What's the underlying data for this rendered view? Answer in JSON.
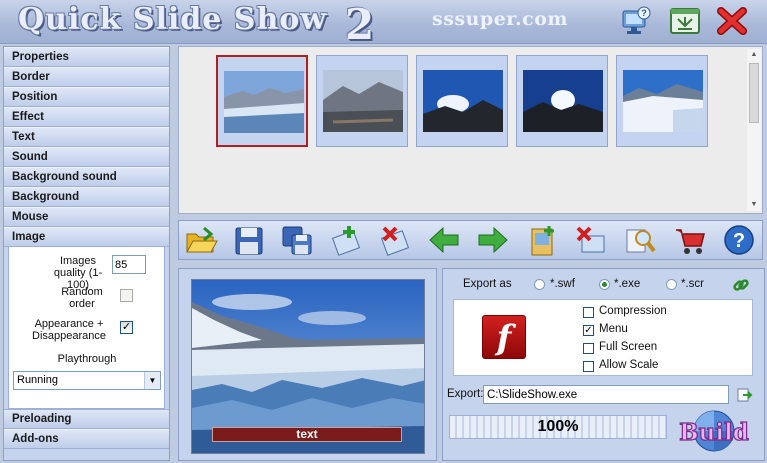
{
  "app": {
    "title": "Quick Slide Show",
    "version": "2",
    "brand": "sssuper.com"
  },
  "window_buttons": [
    "help-monitor",
    "restore",
    "close"
  ],
  "sidebar": {
    "sections_top": [
      {
        "label": "Properties"
      },
      {
        "label": "Border"
      },
      {
        "label": "Position"
      },
      {
        "label": "Effect"
      },
      {
        "label": "Text"
      },
      {
        "label": "Sound"
      },
      {
        "label": "Background sound"
      },
      {
        "label": "Background"
      },
      {
        "label": "Mouse"
      },
      {
        "label": "Image"
      }
    ],
    "image_panel": {
      "quality_label": "Images quality (1-100)",
      "quality_value": "85",
      "random_label": "Random order",
      "random_checked": false,
      "appearance_label": "Appearance + Disappearance",
      "appearance_checked": true,
      "playthrough_label": "Playthrough",
      "playthrough_value": "Running"
    },
    "sections_bottom": [
      {
        "label": "Preloading"
      },
      {
        "label": "Add-ons"
      }
    ]
  },
  "thumbnails": {
    "selected_index": 0,
    "count": 5
  },
  "toolbar": {
    "icons": [
      "open-folder-icon",
      "save-icon",
      "save-as-icon",
      "add-image-icon",
      "remove-image-icon",
      "move-left-icon",
      "move-right-icon",
      "add-to-album-icon",
      "delete-icon",
      "zoom-icon",
      "cart-icon",
      "help-icon"
    ]
  },
  "preview": {
    "caption": "text"
  },
  "export": {
    "export_as_label": "Export as",
    "formats": [
      {
        "label": "*.swf",
        "selected": false
      },
      {
        "label": "*.exe",
        "selected": true
      },
      {
        "label": "*.scr",
        "selected": false
      }
    ],
    "options": [
      {
        "label": "Compression",
        "checked": false
      },
      {
        "label": "Menu",
        "checked": true
      },
      {
        "label": "Full Screen",
        "checked": false
      },
      {
        "label": "Allow Scale",
        "checked": false
      }
    ],
    "path_label": "Export:",
    "path_value": "C:\\SlideShow.exe",
    "progress_text": "100%",
    "progress": 1.0,
    "build_label": "Build"
  },
  "colors": {
    "accent": "#b12020",
    "panel": "#c6d3ec",
    "header": "#a9b8d8"
  }
}
